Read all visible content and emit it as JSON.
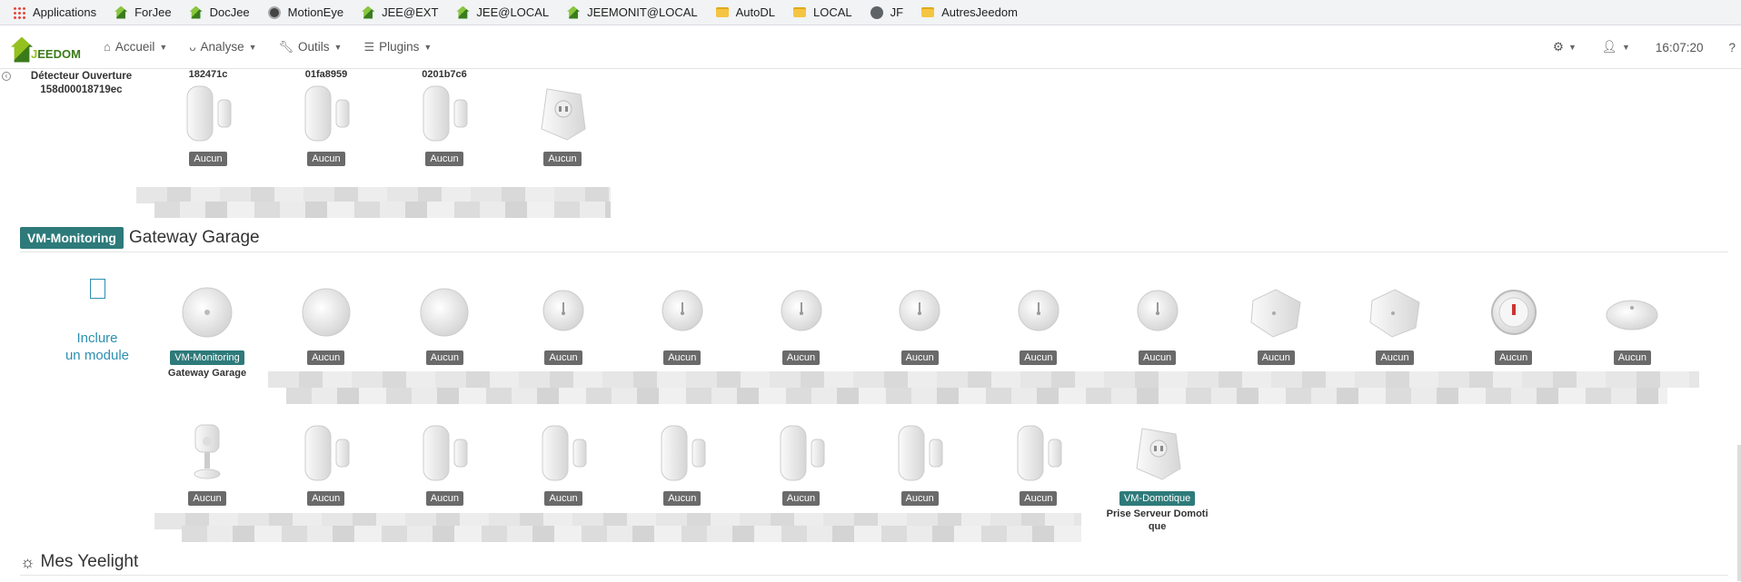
{
  "bookmarks": [
    {
      "label": "Applications",
      "icon": "apps-grid-icon"
    },
    {
      "label": "ForJee",
      "icon": "jeedom-icon"
    },
    {
      "label": "DocJee",
      "icon": "jeedom-icon"
    },
    {
      "label": "MotionEye",
      "icon": "owl-icon"
    },
    {
      "label": "JEE@EXT",
      "icon": "jeedom-icon"
    },
    {
      "label": "JEE@LOCAL",
      "icon": "jeedom-icon"
    },
    {
      "label": "JEEMONIT@LOCAL",
      "icon": "jeedom-icon"
    },
    {
      "label": "AutoDL",
      "icon": "folder-icon"
    },
    {
      "label": "LOCAL",
      "icon": "folder-icon"
    },
    {
      "label": "JF",
      "icon": "globe-icon"
    },
    {
      "label": "AutresJeedom",
      "icon": "folder-icon"
    }
  ],
  "navbar": {
    "logo_text_a": "J",
    "logo_text_b": "EEDOM",
    "menu": [
      {
        "label": "Accueil",
        "icon": "home-icon"
      },
      {
        "label": "Analyse",
        "icon": "stethoscope-icon"
      },
      {
        "label": "Outils",
        "icon": "wrench-icon"
      },
      {
        "label": "Plugins",
        "icon": "list-icon"
      }
    ],
    "time": "16:07:20"
  },
  "top_group": {
    "left_title_line1": "Détecteur Ouverture",
    "left_title_line2": "158d00018719ec",
    "cards": [
      {
        "title": "182471c",
        "badge": "Aucun",
        "kind": "door"
      },
      {
        "title": "01fa8959",
        "badge": "Aucun",
        "kind": "door"
      },
      {
        "title": "0201b7c6",
        "badge": "Aucun",
        "kind": "door"
      },
      {
        "title": "",
        "badge": "Aucun",
        "kind": "plug"
      }
    ]
  },
  "gateway_section": {
    "tag": "VM-Monitoring",
    "name": "Gateway Garage",
    "include_line1": "Inclure",
    "include_line2": "un module",
    "row1": [
      {
        "kind": "gateway",
        "badge": "VM-Monitoring",
        "badge_style": "teal",
        "sub": "Gateway Garage"
      },
      {
        "kind": "button",
        "badge": "Aucun"
      },
      {
        "kind": "button",
        "badge": "Aucun"
      },
      {
        "kind": "temp",
        "badge": "Aucun"
      },
      {
        "kind": "temp",
        "badge": "Aucun"
      },
      {
        "kind": "temp",
        "badge": "Aucun"
      },
      {
        "kind": "temp",
        "badge": "Aucun"
      },
      {
        "kind": "temp",
        "badge": "Aucun"
      },
      {
        "kind": "temp",
        "badge": "Aucun"
      },
      {
        "kind": "cube",
        "badge": "Aucun"
      },
      {
        "kind": "cube",
        "badge": "Aucun"
      },
      {
        "kind": "knob",
        "badge": "Aucun"
      },
      {
        "kind": "water",
        "badge": "Aucun"
      }
    ],
    "row2": [
      {
        "kind": "motion",
        "badge": "Aucun"
      },
      {
        "kind": "door",
        "badge": "Aucun"
      },
      {
        "kind": "door",
        "badge": "Aucun"
      },
      {
        "kind": "door",
        "badge": "Aucun"
      },
      {
        "kind": "door",
        "badge": "Aucun"
      },
      {
        "kind": "door",
        "badge": "Aucun"
      },
      {
        "kind": "door",
        "badge": "Aucun"
      },
      {
        "kind": "door",
        "badge": "Aucun"
      },
      {
        "kind": "plug",
        "badge": "VM-Domotique",
        "badge_style": "teal",
        "sub1": "Prise Serveur Domoti",
        "sub2": "que"
      }
    ]
  },
  "yeelight_section": {
    "name": "Mes Yeelight"
  }
}
